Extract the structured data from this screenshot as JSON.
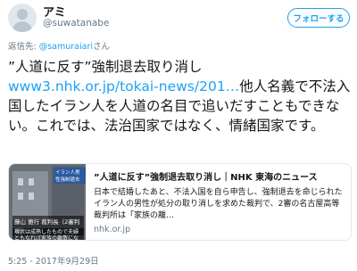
{
  "user": {
    "name": "アミ",
    "handle": "@suwatanabe"
  },
  "follow_button": {
    "label": "フォローする"
  },
  "reply": {
    "prefix": "返信先: ",
    "mention": "@samuraiari",
    "suffix": "さん"
  },
  "tweet": {
    "line1": "”人道に反す”強制退去取り消し",
    "link": "www3.nhk.or.jp/tokai-news/201…",
    "text_after_link": "他人名義で不法入国したイラン人を人道の名目で追いだすこともできない。これでは、法治国家ではなく、情緒国家です。"
  },
  "card": {
    "title": "”人道に反す”強制退去取り消し｜NHK 東海のニュース",
    "description": "日本で結婚したあと、不法入国を自ら申告し、強制退去を命じられたイラン人の男性が処分の取り消しを求めた裁判で、2審の名古屋高等裁判所は「家族の離…",
    "domain": "nhk.or.jp",
    "thumb_caption_1": "イラン人男性強制退去",
    "thumb_caption_2": "藤山 雅行 裁判長（2審判決）",
    "thumb_caption_3": "現状は成熟したもので夫婦ともなれば家族の離散になりかね"
  },
  "timestamp": "5:25 - 2017年9月29日"
}
